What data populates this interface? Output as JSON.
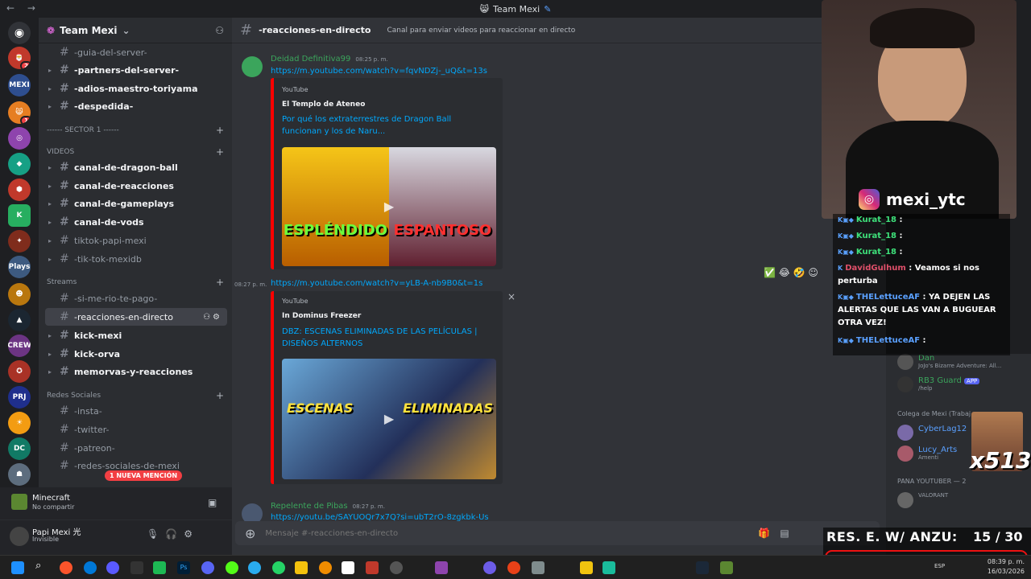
{
  "titlebar": {
    "title": "Team Mexi"
  },
  "guild": {
    "name": "Team Mexi"
  },
  "channels": [
    {
      "name": "-guia-del-server-",
      "y": 0
    },
    {
      "name": "-partners-del-server-"
    },
    {
      "name": "-adios-maestro-toriyama"
    },
    {
      "name": "-despedida-"
    }
  ],
  "categories": {
    "sector": "------ SECTOR 1 ------",
    "videos": "VIDEOS",
    "streams": "Streams",
    "redes": "Redes Sociales"
  },
  "video_channels": [
    "canal-de-dragon-ball",
    "canal-de-reacciones",
    "canal-de-gameplays",
    "canal-de-vods",
    "tiktok-papi-mexi",
    "-tik-tok-mexidb"
  ],
  "stream_channels": [
    "-si-me-rio-te-pago-",
    "-reacciones-en-directo",
    "kick-mexi",
    "kick-orva",
    "memorvas-y-reacciones"
  ],
  "redes_channels": [
    "-insta-",
    "-twitter-",
    "-patreon-",
    "-redes-sociales-de-mexi"
  ],
  "mention_badge": "1 NUEVA MENCIÓN",
  "activity": {
    "game": "Minecraft",
    "status": "No compartir"
  },
  "user": {
    "name": "Papi Mexi 光",
    "status": "Invisible"
  },
  "chat_header": {
    "channel": "-reacciones-en-directo",
    "topic": "Canal para enviar videos para reaccionar en directo"
  },
  "messages": [
    {
      "author": "Deidad Definitiva99",
      "time": "08:25 p. m.",
      "link": "https://m.youtube.com/watch?v=fqvNDZj-_uQ&t=13s",
      "embed": {
        "provider": "YouTube",
        "author": "El Templo de Ateneo",
        "title": "Por qué los extraterrestres de Dragon Ball funcionan y los de Naru...",
        "thumb_left": "ESPLÉNDIDO",
        "thumb_right": "ESPANTOSO"
      }
    },
    {
      "time": "08:27 p. m.",
      "link": "https://m.youtube.com/watch?v=yLB-A-nb9B0&t=1s",
      "embed": {
        "provider": "YouTube",
        "author": "In Dominus Freezer",
        "title": "DBZ: ESCENAS ELIMINADAS DE LAS PELÍCULAS | DISEÑOS ALTERNOS",
        "thumb_left": "ESCENAS",
        "thumb_right": "ELIMINADAS"
      }
    },
    {
      "author": "Repelente de Pibas",
      "time": "08:27 p. m.",
      "link": "https://youtu.be/SAYUOQr7x7Q?si=ubT2rO-8zgkbk-Us"
    }
  ],
  "composer": {
    "placeholder": "Mensaje #-reacciones-en-directo"
  },
  "members": {
    "group1": "Colega de Mexi (Trabaj...",
    "group2": "PANA YOUTUBER — 2",
    "list": [
      {
        "name": "Dan",
        "status": "JoJo's Bizarre Adventure: All..."
      },
      {
        "name": "RB3 Guard",
        "status": "/help",
        "tag": "APP"
      },
      {
        "name": "CyberLag12",
        "status": ""
      },
      {
        "name": "Lucy_Arts",
        "status": "Amenti"
      },
      {
        "name": "",
        "status": "VALORANT"
      }
    ]
  },
  "stream": {
    "instagram": "mexi_ytc",
    "chat": [
      {
        "user": "Kurat_18",
        "msg": ""
      },
      {
        "user": "Kurat_18",
        "msg": ""
      },
      {
        "user": "Kurat_18",
        "msg": ""
      },
      {
        "user": "DavidGulhum",
        "msg": "Veamos si nos perturba"
      },
      {
        "user": "THELettuceAF",
        "msg": "YA DEJEN LAS ALERTAS QUE LAS VAN A BUGUEAR OTRA VEZ!"
      },
      {
        "user": "THELettuceAF",
        "msg": ""
      }
    ],
    "counter_label": "RES. E. W/ ANZU:",
    "counter_value": "15  / 30",
    "counter_progress": 0.5,
    "multiplier": "x513"
  },
  "taskbar": {
    "time": "08:39 p. m.",
    "date": "16/03/2026",
    "lang": "ESP"
  },
  "colors": {
    "accent": "#5865f2",
    "embed_border": "#ff0000",
    "link": "#00a8fc",
    "bg": "#313338"
  }
}
